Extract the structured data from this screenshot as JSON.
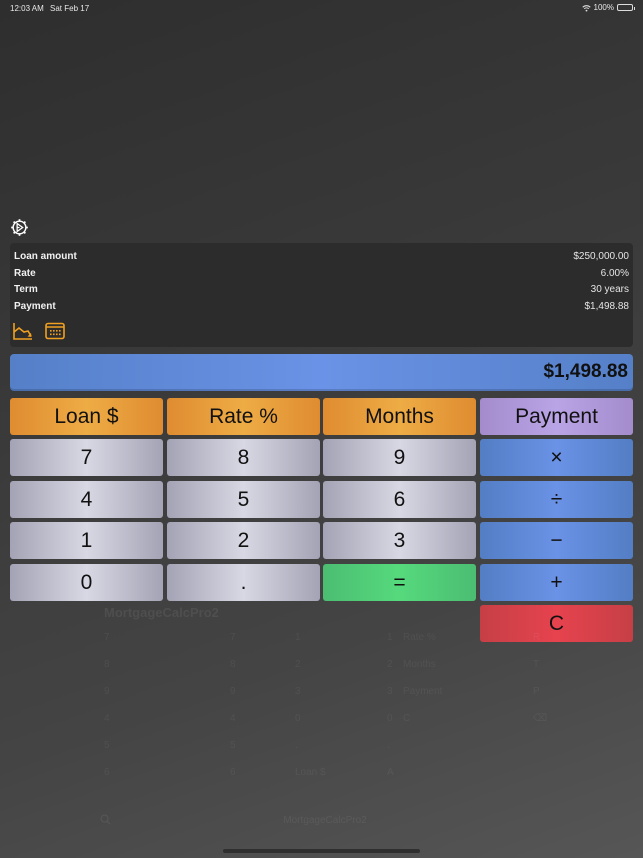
{
  "status_bar": {
    "time": "12:03 AM",
    "date": "Sat Feb 17",
    "battery": "100%",
    "battery_level": 1.0
  },
  "summary": {
    "rows": [
      {
        "label": "Loan amount",
        "value": "$250,000.00"
      },
      {
        "label": "Rate",
        "value": "6.00%"
      },
      {
        "label": "Term",
        "value": "30 years"
      },
      {
        "label": "Payment",
        "value": "$1,498.88"
      }
    ],
    "icons": [
      "chart-declining-icon",
      "calendar-icon"
    ]
  },
  "display": {
    "value": "$1,498.88"
  },
  "keys": {
    "loan": "Loan $",
    "rate": "Rate %",
    "months": "Months",
    "payment": "Payment",
    "seven": "7",
    "eight": "8",
    "nine": "9",
    "multiply": "×",
    "four": "4",
    "five": "5",
    "six": "6",
    "divide": "÷",
    "one": "1",
    "two": "2",
    "three": "3",
    "minus": "−",
    "zero": "0",
    "dot": ".",
    "equals": "=",
    "plus": "+",
    "clear": "C"
  },
  "shortcuts_overlay": {
    "title": "MortgageCalcPro2",
    "col1": [
      {
        "label": "7",
        "key": "7"
      },
      {
        "label": "8",
        "key": "8"
      },
      {
        "label": "9",
        "key": "9"
      },
      {
        "label": "4",
        "key": "4"
      },
      {
        "label": "5",
        "key": "5"
      },
      {
        "label": "6",
        "key": "6"
      }
    ],
    "col2": [
      {
        "label": "1",
        "key": "1"
      },
      {
        "label": "2",
        "key": "2"
      },
      {
        "label": "3",
        "key": "3"
      },
      {
        "label": "0",
        "key": "0"
      },
      {
        "label": ".",
        "key": "."
      },
      {
        "label": "Loan $",
        "key": "A"
      }
    ],
    "col3": [
      {
        "label": "Rate %",
        "key": "R"
      },
      {
        "label": "Months",
        "key": "T"
      },
      {
        "label": "Payment",
        "key": "P"
      },
      {
        "label": "C",
        "key": "⌫"
      }
    ],
    "search_label": "MortgageCalcPro2"
  },
  "colors": {
    "orange": "#eeac45",
    "purple": "#b9a4e6",
    "silver": "#d8d8e4",
    "blue": "#6a92e6",
    "green": "#56d97d",
    "red": "#e6434e",
    "icon_accent": "#f0a020"
  }
}
